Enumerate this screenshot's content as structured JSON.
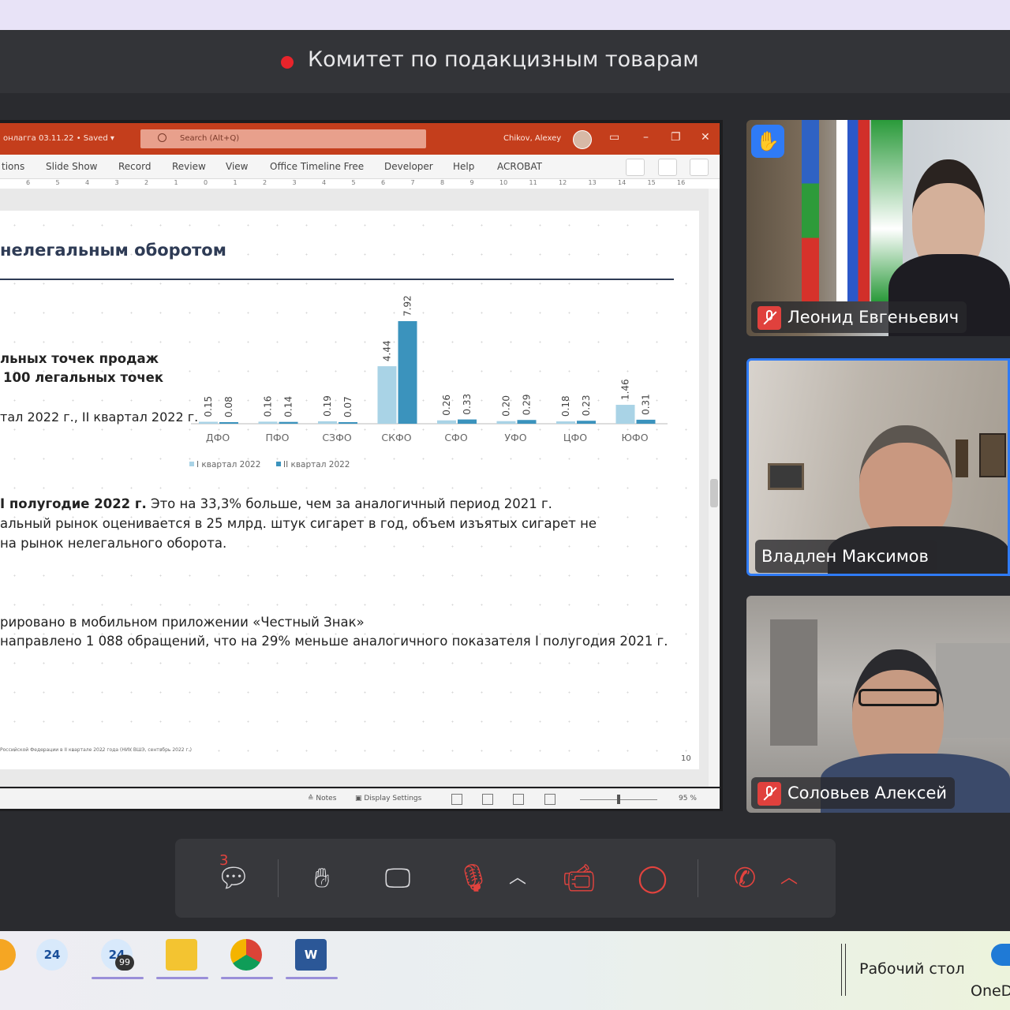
{
  "window": {
    "title": "Комитет по подакцизным товарам",
    "recording_color": "#e8242b"
  },
  "powerpoint": {
    "doc_title": "онлагга 03.11.22 • Saved ▾",
    "search_placeholder": "Search (Alt+Q)",
    "user": "Chikov, Alexey",
    "ribbon_tabs": [
      "tions",
      "Slide Show",
      "Record",
      "Review",
      "View",
      "Office Timeline Free",
      "Developer",
      "Help",
      "ACROBAT"
    ],
    "ruler_marks": [
      "6",
      "5",
      "4",
      "3",
      "2",
      "1",
      "0",
      "1",
      "2",
      "3",
      "4",
      "5",
      "6",
      "7",
      "8",
      "9",
      "10",
      "11",
      "12",
      "13",
      "14",
      "15",
      "16"
    ],
    "status": {
      "notes": "Notes",
      "display_settings": "Display Settings",
      "zoom": "95 %"
    }
  },
  "slide": {
    "title": "нелегальным оборотом",
    "text_line1": "льных точек продаж",
    "text_line2": "100 легальных точек",
    "text_line3": "тал 2022 г., II квартал 2022 г.",
    "para1_bold": "I полугодие 2022 г.",
    "para1_rest": " Это на 33,3% больше, чем за аналогичный период 2021 г.",
    "para2": "альный рынок оценивается в 25 млрд. штук сигарет в год, объем изъятых сигарет не",
    "para3": "на рынок нелегального оборота.",
    "para4": "рировано в мобильном приложении «Честный Знак»",
    "para5": "направлено 1 088 обращений, что на 29% меньше аналогичного показателя I полугодия 2021 г.",
    "footnote": "Российской Федерации в II квартале 2022 года (НИУ ВШЭ, сентябрь 2022 г.)",
    "page_number": "10"
  },
  "chart_data": {
    "type": "bar",
    "categories": [
      "ДФО",
      "ПФО",
      "СЗФО",
      "СКФО",
      "СФО",
      "УФО",
      "ЦФО",
      "ЮФО"
    ],
    "series": [
      {
        "name": "I квартал 2022",
        "values": [
          0.15,
          0.16,
          0.19,
          4.44,
          0.26,
          0.2,
          0.18,
          1.46
        ],
        "labels": [
          "0.15",
          "0.16",
          "0.19",
          "4.44",
          "0.26",
          "0.20",
          "0.18",
          "1.46"
        ],
        "color": "#a9d3e6"
      },
      {
        "name": "II квартал 2022",
        "values": [
          0.08,
          0.14,
          0.07,
          7.92,
          0.33,
          0.29,
          0.23,
          0.31
        ],
        "labels": [
          "0.08",
          "0.14",
          "0.07",
          "7.92",
          "0.33",
          "0.29",
          "0.23",
          "0.31"
        ],
        "color": "#3b93bd"
      }
    ],
    "ylim": [
      0,
      8.5
    ],
    "legend": [
      "I квартал 2022",
      "II квартал 2022"
    ],
    "legend_position": "bottom",
    "grid": false
  },
  "participants": [
    {
      "name": "Леонид Евгеньевич",
      "muted": true,
      "hand_raised": true
    },
    {
      "name": "Владлен Максимов",
      "muted": false,
      "active_speaker": true
    },
    {
      "name": "Соловьев Алексей",
      "muted": true
    }
  ],
  "controls": {
    "chat_count": "3",
    "items": [
      "chat-icon",
      "raise-hand-icon",
      "screen-share-icon",
      "microphone-muted-icon",
      "camera-off-icon",
      "record-icon",
      "leave-call-icon"
    ]
  },
  "taskbar": {
    "badges": {
      "app1": "24",
      "app2": "24",
      "app2_count": "99"
    },
    "desktop_label": "Рабочий стол",
    "onedrive_label": "OneD"
  }
}
